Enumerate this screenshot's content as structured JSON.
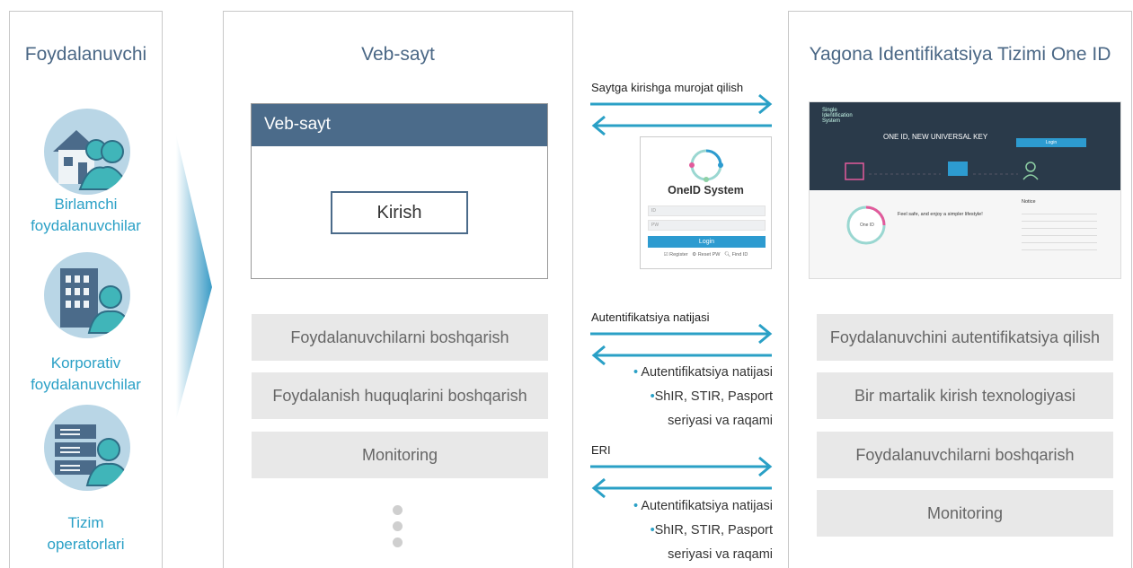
{
  "users": {
    "title": "Foydalanuvchi",
    "groups": [
      {
        "label_line1": "Birlamchi",
        "label_line2": "foydalanuvchilar",
        "icon": "house-user-icon"
      },
      {
        "label_line1": "Korporativ",
        "label_line2": "foydalanuvchilar",
        "icon": "building-user-icon"
      },
      {
        "label_line1": "Tizim",
        "label_line2": "operatorlari",
        "icon": "server-user-icon"
      }
    ]
  },
  "website": {
    "title": "Veb-sayt",
    "window_title": "Veb-sayt",
    "login_button": "Kirish",
    "functions": [
      "Foydalanuvchilarni boshqarish",
      "Foydalanish huquqlarini boshqarish",
      "Monitoring"
    ]
  },
  "flows": {
    "request_label": "Saytga kirishga murojat qilish",
    "auth_label": "Autentifikatsiya natijasi",
    "auth_bullets": [
      "Autentifikatsiya natijasi",
      "ShIR, STIR, Pasport",
      "seriyasi va raqami"
    ],
    "eri_label": "ERI",
    "eri_bullets": [
      "Autentifikatsiya natijasi",
      "ShIR, STIR, Pasport",
      "seriyasi va raqami"
    ]
  },
  "oneid_card": {
    "title": "OneID System",
    "id_placeholder": "ID",
    "pw_placeholder": "PW",
    "login_button": "Login",
    "links": [
      "Register",
      "Reset PW",
      "Find ID"
    ]
  },
  "oneid": {
    "title": "Yagona Identifikatsiya Tizimi One ID",
    "functions": [
      "Foydalanuvchini autentifikatsiya qilish",
      "Bir martalik kirish texnologiyasi",
      "Foydalanuvchilarni boshqarish",
      "Monitoring"
    ],
    "screenshot": {
      "logo": "Single Identification System",
      "slogan": "ONE ID, NEW UNIVERSAL KEY",
      "login": "Login",
      "tagline": "Feel safe, and enjoy a simpler lifestyle!",
      "notice": "Notice",
      "badge": "One ID"
    }
  },
  "colors": {
    "accent": "#2aa0c6",
    "header": "#4b6b8a",
    "arrow": "#2aa0c6",
    "title": "#4a6785",
    "gray_box": "#e8e8e8"
  }
}
